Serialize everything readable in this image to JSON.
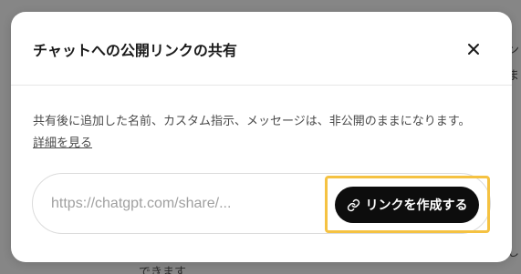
{
  "background": {
    "fragment_right_top": "ン",
    "fragment_right_mid": "ま",
    "fragment_right_bottom": "し",
    "fragment_bottom": "できます"
  },
  "modal": {
    "title": "チャットへの公開リンクの共有",
    "close_icon": "close-icon",
    "description": "共有後に追加した名前、カスタム指示、メッセージは、非公開のままになります。",
    "details_link": "詳細を見る",
    "share_url_placeholder": "https://chatgpt.com/share/...",
    "create_link_icon": "link-icon",
    "create_link_label": "リンクを作成する"
  },
  "colors": {
    "highlight": "#f5c242",
    "button_bg": "#0d0d0d",
    "overlay": "#868686"
  }
}
